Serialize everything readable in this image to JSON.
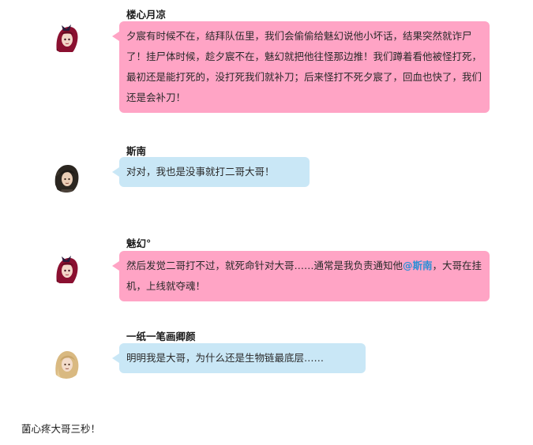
{
  "messages": [
    {
      "name": "楼心月凉",
      "text": "夕宸有时候不在，结拜队伍里，我们会偷偷给魅幻说他小坏话，结果突然就诈尸了！挂尸体时候，趁夕宸不在，魅幻就把他往怪那边推！我们蹲着看他被怪打死，最初还是能打死的，没打死我们就补刀；后来怪打不死夕宸了，回血也快了，我们还是会补刀！",
      "bubble_color": "#ffa4c5",
      "avatar_icon": "red-haired-female-avatar"
    },
    {
      "name": "斯南",
      "text": "对对，我也是没事就打二哥大哥！",
      "bubble_color": "#c9e7f6",
      "avatar_icon": "dark-haired-male-avatar"
    },
    {
      "name": "魅幻°",
      "text_before": "然后发觉二哥打不过，就死命针对大哥……通常是我负责通知他",
      "mention": "@斯南",
      "text_after": "，大哥在挂机，上线就夺魂！",
      "bubble_color": "#ffa4c5",
      "avatar_icon": "red-haired-female-avatar"
    },
    {
      "name": "一纸一笔画卿颜",
      "text": "明明我是大哥，为什么还是生物链最底层……",
      "bubble_color": "#c9e7f6",
      "avatar_icon": "blonde-male-avatar"
    }
  ],
  "footer_text": "菌心疼大哥三秒！",
  "colors": {
    "pink_bubble": "#ffa4c5",
    "blue_bubble": "#c9e7f6",
    "mention": "#2c8fd6"
  }
}
